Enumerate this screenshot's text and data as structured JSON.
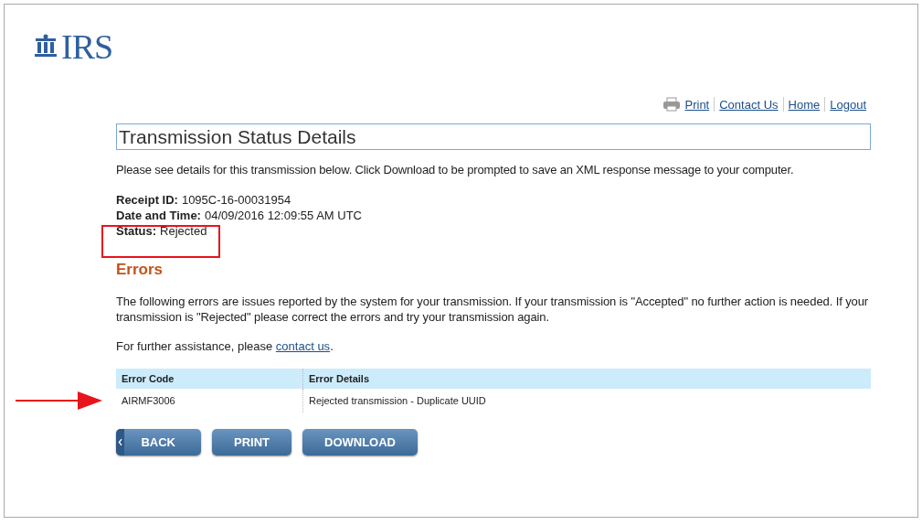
{
  "header": {
    "logo": "IRS"
  },
  "top_links": [
    {
      "label": "Print",
      "kind": "print"
    },
    {
      "label": "Contact Us",
      "kind": "link"
    },
    {
      "label": "Home",
      "kind": "link"
    },
    {
      "label": "Logout",
      "kind": "link"
    }
  ],
  "title": "Transmission Status Details",
  "intro": "Please see details for this transmission below. Click Download to be prompted to save an XML response message to your computer.",
  "details": [
    {
      "label": "Receipt ID:",
      "value": "1095C-16-00031954"
    },
    {
      "label": "Date and Time:",
      "value": "04/09/2016 12:09:55 AM UTC"
    },
    {
      "label": "Status:",
      "value": "Rejected"
    }
  ],
  "errors": {
    "heading": "Errors",
    "text": "The following errors are issues reported by the system for your transmission. If your transmission is \"Accepted\" no further action is needed. If your transmission is \"Rejected\" please correct the errors and try your transmission again.",
    "assist_prefix": "For further assistance, please ",
    "assist_link": "contact us",
    "assist_suffix": "."
  },
  "table": {
    "columns": [
      "Error Code",
      "Error Details"
    ],
    "rows": [
      [
        "AIRMF3006",
        "Rejected transmission - Duplicate UUID"
      ]
    ]
  },
  "buttons": [
    {
      "label": "BACK",
      "kind": "back"
    },
    {
      "label": "PRINT",
      "kind": "plain"
    },
    {
      "label": "DOWNLOAD",
      "kind": "plain"
    }
  ]
}
